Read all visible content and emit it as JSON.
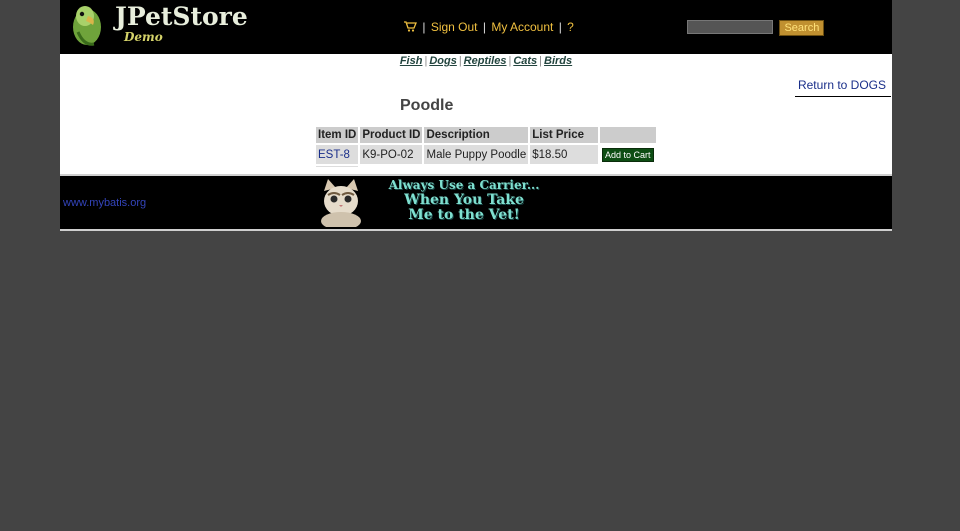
{
  "header": {
    "logo_main": "JPetStore",
    "logo_sub": "Demo",
    "menu": {
      "sign_out": "Sign Out",
      "my_account": "My Account",
      "help": "?"
    },
    "search": {
      "value": "",
      "placeholder": "",
      "button_label": "Search"
    }
  },
  "quick_links": [
    "Fish",
    "Dogs",
    "Reptiles",
    "Cats",
    "Birds"
  ],
  "content": {
    "back_link": "Return to DOGS",
    "title": "Poodle",
    "table": {
      "headers": [
        "Item ID",
        "Product ID",
        "Description",
        "List Price",
        ""
      ],
      "rows": [
        {
          "item_id": "EST-8",
          "product_id": "K9-PO-02",
          "description": "Male Puppy Poodle",
          "price": "$18.50",
          "action": "Add to Cart"
        }
      ]
    }
  },
  "footer": {
    "link": "www.mybatis.org",
    "banner_lines": [
      "Always Use a Carrier...",
      "When You Take",
      "Me to the Vet!"
    ]
  }
}
